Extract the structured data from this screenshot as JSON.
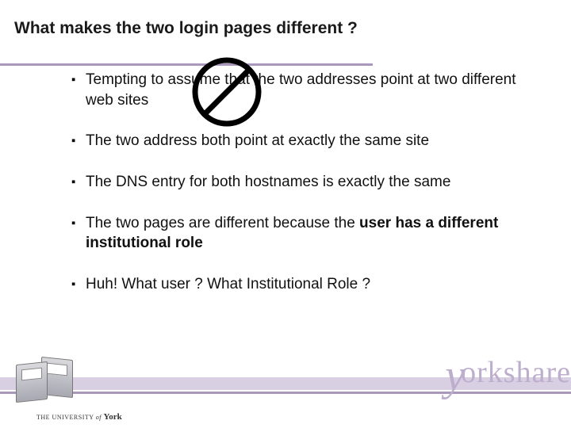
{
  "title": "What makes the two login pages different ?",
  "bullets": [
    {
      "pre": "Tempting to assume that the two addresses point at two different web sites",
      "bold": "",
      "post": ""
    },
    {
      "pre": "The two address both point at exactly the same site",
      "bold": "",
      "post": ""
    },
    {
      "pre": "The DNS entry for both hostnames is exactly the same",
      "bold": "",
      "post": ""
    },
    {
      "pre": "The two pages are different because the ",
      "bold": "user has a different institutional role",
      "post": ""
    },
    {
      "pre": "Huh! What user ? What Institutional Role ?",
      "bold": "",
      "post": ""
    }
  ],
  "branding": {
    "logo_y": "y",
    "logo_rest": "orkshare",
    "university_pre": "THE UNIVERSITY ",
    "university_of": "of ",
    "university_name": "York"
  }
}
